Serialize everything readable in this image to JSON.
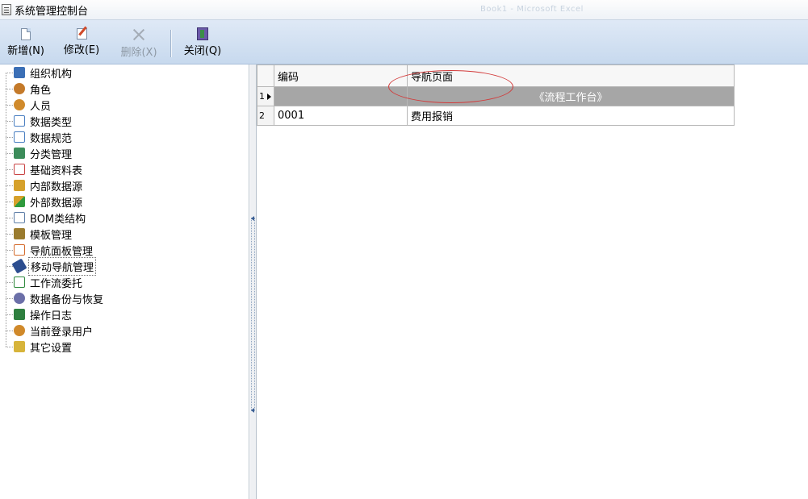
{
  "window": {
    "title": "系统管理控制台",
    "ghost_tab_1": "Book1 - Microsoft Excel"
  },
  "toolbar": {
    "buttons": [
      {
        "label": "新增(N)",
        "icon": "new-document-icon",
        "enabled": true
      },
      {
        "label": "修改(E)",
        "icon": "edit-icon",
        "enabled": true
      },
      {
        "label": "删除(X)",
        "icon": "delete-icon",
        "enabled": false
      },
      {
        "label": "关闭(Q)",
        "icon": "door-exit-icon",
        "enabled": true
      }
    ]
  },
  "tree": {
    "items": [
      {
        "label": "组织机构",
        "icon": "org-chart-icon",
        "color": "#3b6fb6"
      },
      {
        "label": "角色",
        "icon": "role-users-icon",
        "color": "#c47a2a"
      },
      {
        "label": "人员",
        "icon": "person-icon",
        "color": "#d08a2b"
      },
      {
        "label": "数据类型",
        "icon": "data-type-icon",
        "color": "#4a7fc1"
      },
      {
        "label": "数据规范",
        "icon": "data-spec-icon",
        "color": "#4a7fc1"
      },
      {
        "label": "分类管理",
        "icon": "category-icon",
        "color": "#3c8c5a"
      },
      {
        "label": "基础资料表",
        "icon": "base-table-icon",
        "color": "#c94343"
      },
      {
        "label": "内部数据源",
        "icon": "internal-source-icon",
        "color": "#d6a12b"
      },
      {
        "label": "外部数据源",
        "icon": "external-source-icon",
        "color": "#2f9a3d"
      },
      {
        "label": "BOM类结构",
        "icon": "bom-structure-icon",
        "color": "#5f7fa8"
      },
      {
        "label": "模板管理",
        "icon": "template-icon",
        "color": "#9a7b2e"
      },
      {
        "label": "导航面板管理",
        "icon": "nav-panel-icon",
        "color": "#d46a2b"
      },
      {
        "label": "移动导航管理",
        "icon": "mobile-nav-icon",
        "color": "#2c4d8f"
      },
      {
        "label": "工作流委托",
        "icon": "workflow-icon",
        "color": "#2f8a3d"
      },
      {
        "label": "数据备份与恢复",
        "icon": "backup-icon",
        "color": "#6b6fa8"
      },
      {
        "label": "操作日志",
        "icon": "log-book-icon",
        "color": "#2e7f3f"
      },
      {
        "label": "当前登录用户",
        "icon": "logged-user-icon",
        "color": "#d0892a"
      },
      {
        "label": "其它设置",
        "icon": "settings-folder-icon",
        "color": "#d7b43a"
      }
    ],
    "selected_index": 12
  },
  "grid": {
    "headers": [
      "编码",
      "导航页面"
    ],
    "group_label": "《流程工作台》",
    "rows": [
      {
        "num": "1",
        "code": "",
        "page": ""
      },
      {
        "num": "2",
        "code": "0001",
        "page": "费用报销"
      }
    ]
  }
}
